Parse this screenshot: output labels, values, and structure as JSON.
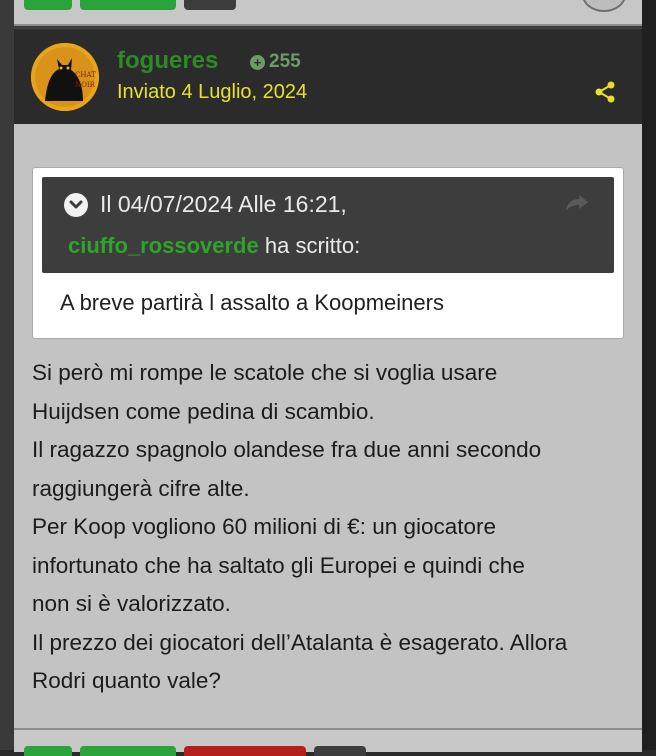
{
  "post": {
    "author": "fogueres",
    "reputation": "255",
    "date": "Inviato 4 Luglio, 2024",
    "quote": {
      "header_date": "Il 04/07/2024 Alle 16:21,",
      "user": "ciuffo_rossoverde",
      "wrote": "ha scritto:",
      "text": "A breve partirà l assalto a Koopmeiners"
    },
    "lines": [
      "Si però mi rompe le scatole che si voglia usare",
      "Huijdsen come pedina di scambio.",
      "Il ragazzo spagnolo olandese fra due anni secondo",
      "raggiungerà cifre alte.",
      "Per Koop vogliono 60 milioni di €: un giocatore",
      "infortunato che ha saltato gli Europei  e quindi che",
      "non si è valorizzato.",
      "Il prezzo dei giocatori dell’Atalanta è esagerato. Allora",
      "Rodri quanto vale?"
    ]
  },
  "colors": {
    "author_green": "#2d8a26",
    "date_yellow": "#e8e02a",
    "quote_user_green": "#2fa42a",
    "button_green": "#2aa33a",
    "button_red": "#b5201d",
    "button_dark": "#3d3d3d"
  },
  "icons": {
    "reputation": "plus-circle-icon",
    "share": "share-icon",
    "quote_toggle": "chevron-down-icon",
    "quote_jump": "forward-arrow-icon"
  }
}
